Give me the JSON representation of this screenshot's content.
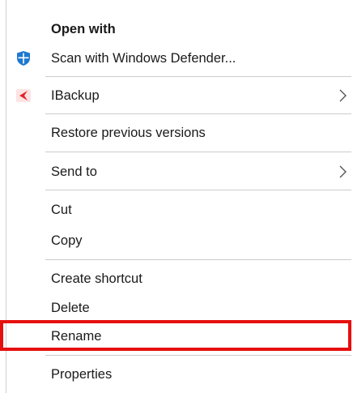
{
  "menu": {
    "open_with": "Open with",
    "scan_defender": "Scan with Windows Defender...",
    "ibackup": "IBackup",
    "restore_previous": "Restore previous versions",
    "send_to": "Send to",
    "cut": "Cut",
    "copy": "Copy",
    "create_shortcut": "Create shortcut",
    "delete": "Delete",
    "rename": "Rename",
    "properties": "Properties"
  },
  "icons": {
    "defender": "windows-defender-shield-icon",
    "ibackup": "ibackup-icon",
    "submenu": "chevron-right-icon"
  },
  "colors": {
    "highlight_border": "#e60f0f",
    "defender_blue": "#1f78d1",
    "ibackup_red": "#e0262a"
  }
}
